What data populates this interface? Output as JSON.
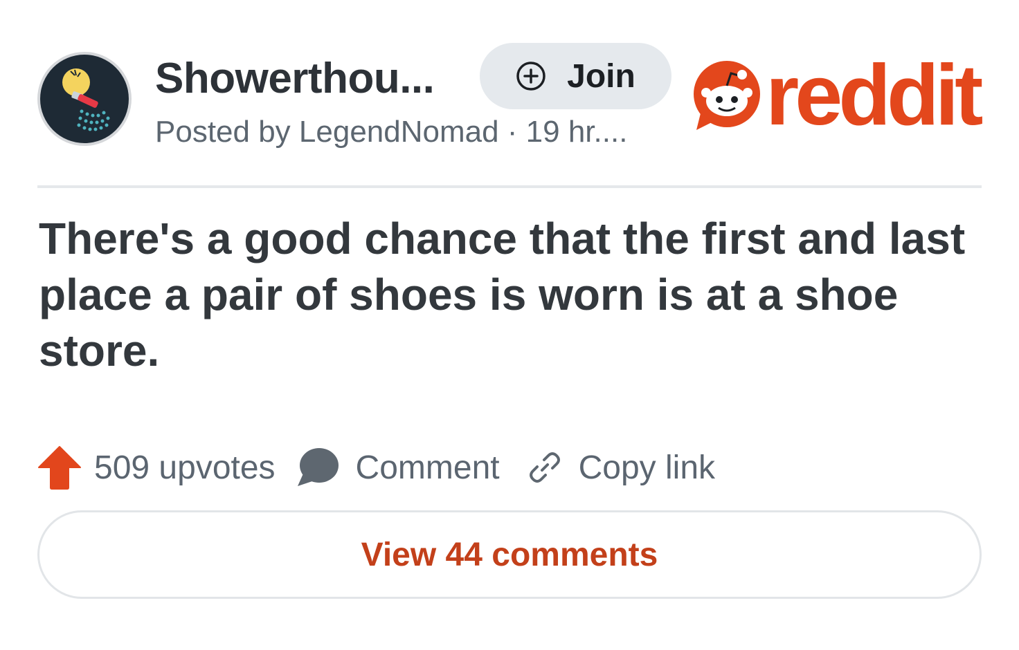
{
  "post": {
    "subreddit_name": "Showerthou...",
    "posted_by": "Posted by LegendNomad · 19 hr....",
    "join_label": "Join",
    "brand_wordmark": "reddit",
    "title": "There's a good chance that the first and last place a pair of shoes is worn is at a shoe store.",
    "upvotes_label": "509 upvotes",
    "comment_label": "Comment",
    "copy_link_label": "Copy link",
    "view_comments_label": "View 44 comments"
  },
  "icons": {
    "subreddit_avatar": "lightbulb-shower-icon",
    "join": "plus-circle-icon",
    "brand": "reddit-snoo-icon",
    "upvote": "upvote-arrow-icon",
    "comment": "speech-bubble-icon",
    "copy_link": "link-icon"
  },
  "colors": {
    "brand": "#e3471c",
    "upvote": "#e2461c",
    "view_comments_text": "#c3401a",
    "join_bg": "#e5e9ed"
  }
}
